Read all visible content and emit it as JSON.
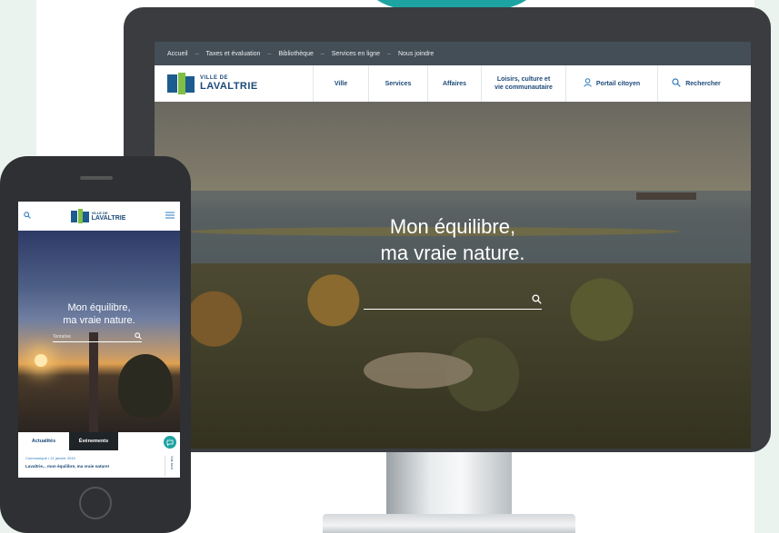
{
  "desktop": {
    "topbar": {
      "items": [
        "Accueil",
        "Taxes et évaluation",
        "Bibliothèque",
        "Services en ligne",
        "Nous joindre"
      ],
      "separator": "–"
    },
    "logo": {
      "line1": "VILLE DE",
      "line2": "LAVALTRIE"
    },
    "nav": {
      "ville": "Ville",
      "services": "Services",
      "affaires": "Affaires",
      "loisirs_line1": "Loisirs, culture et",
      "loisirs_line2": "vie communautaire",
      "portail": "Portail citoyen",
      "recherche": "Rechercher"
    },
    "hero": {
      "title_line1": "Mon équilibre,",
      "title_line2": "ma vraie nature."
    },
    "icons": {
      "portail": "user-icon",
      "recherche": "search-icon",
      "hero_search": "search-icon"
    }
  },
  "mobile": {
    "logo": {
      "line1": "VILLE DE",
      "line2": "LAVALTRIE"
    },
    "hero": {
      "title_line1": "Mon équilibre,",
      "title_line2": "ma vraie nature.",
      "search_placeholder": "Tentative"
    },
    "tabs": {
      "active": "Actualités",
      "inactive": "Événements"
    },
    "news": {
      "meta": "Communiqué  •  21 janvier 2019",
      "headline": "Lavaltrie... mon équilibre, ma vraie nature!",
      "side": "Voir tout"
    },
    "icons": {
      "search": "search-icon",
      "menu": "hamburger-icon",
      "fab": "chat-icon"
    }
  },
  "colors": {
    "brand_blue": "#1d4a7a",
    "brand_green": "#7fbf44",
    "accent_teal": "#1ea3a3",
    "topbar": "#444e57"
  }
}
